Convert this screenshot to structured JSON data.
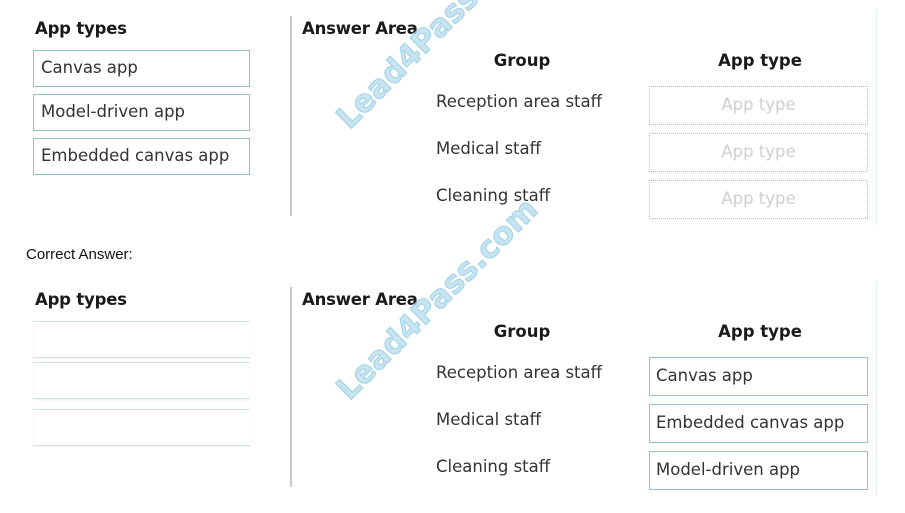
{
  "question": {
    "source_heading": "App types",
    "source_items": [
      {
        "label": "Canvas app"
      },
      {
        "label": "Model-driven app"
      },
      {
        "label": "Embedded canvas app"
      }
    ],
    "answer_heading": "Answer Area",
    "group_header": "Group",
    "apptype_header": "App type",
    "rows": [
      {
        "group": "Reception area staff",
        "value": "App type"
      },
      {
        "group": "Medical staff",
        "value": "App type"
      },
      {
        "group": "Cleaning staff",
        "value": "App type"
      }
    ]
  },
  "correct_answer_label": "Correct Answer:",
  "answer": {
    "source_heading": "App types",
    "source_items": [
      {
        "label": ""
      },
      {
        "label": ""
      },
      {
        "label": ""
      }
    ],
    "answer_heading": "Answer Area",
    "group_header": "Group",
    "apptype_header": "App type",
    "rows": [
      {
        "group": "Reception area staff",
        "value": "Canvas app"
      },
      {
        "group": "Medical staff",
        "value": "Embedded canvas app"
      },
      {
        "group": "Cleaning staff",
        "value": "Model-driven app"
      }
    ]
  },
  "watermark": "Lead4Pass.com",
  "colors": {
    "box_border": "#8fc4cc",
    "placeholder_text": "#cfcfcf",
    "watermark": "#bfe0ef"
  }
}
